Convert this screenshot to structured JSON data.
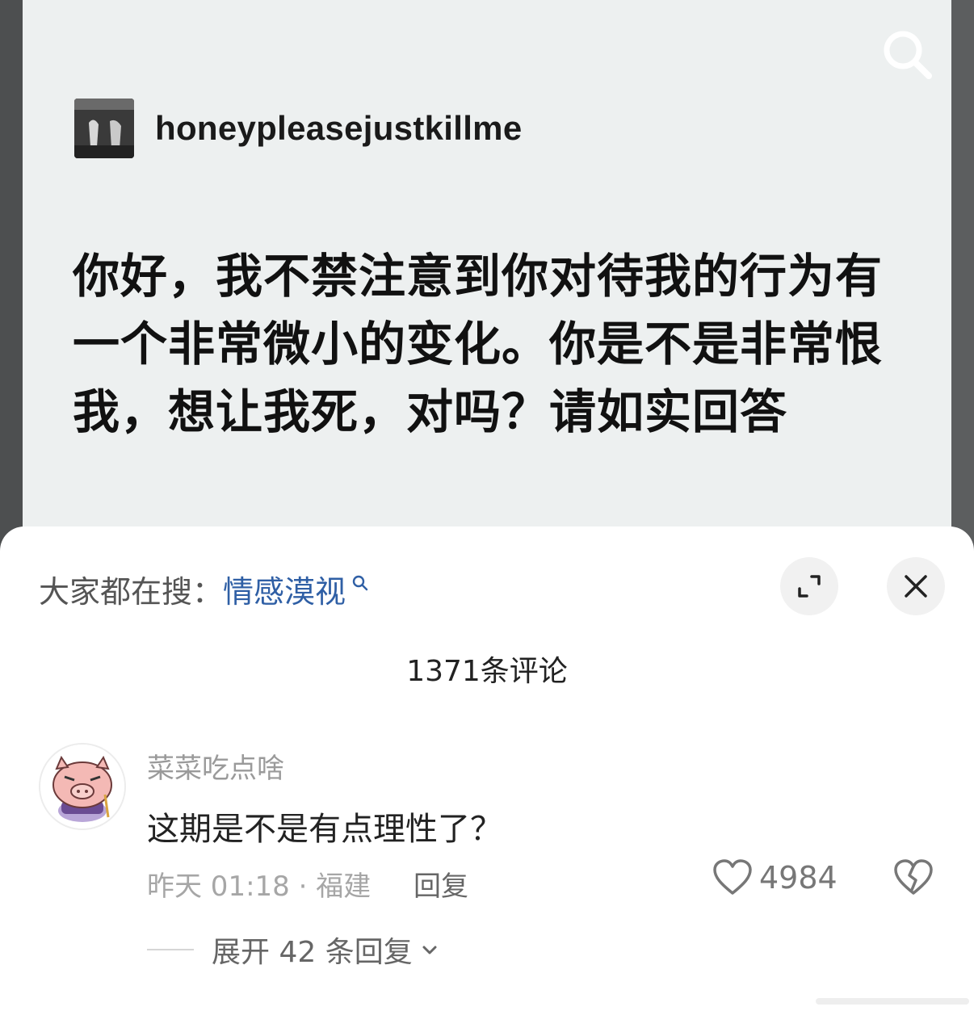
{
  "post": {
    "author": "honeypleasejustkillme",
    "text": "你好，我不禁注意到你对待我的行为有一个非常微小的变化。你是不是非常恨我，想让我死，对吗？请如实回答"
  },
  "sheet": {
    "trending_label": "大家都在搜：",
    "trending_keyword": "情感漠视",
    "comment_count": "1371条评论"
  },
  "comment": {
    "username": "菜菜吃点啥",
    "text": "这期是不是有点理性了？",
    "meta": "昨天 01:18 · 福建",
    "reply_label": "回复",
    "likes": "4984",
    "expand_label": "展开 42 条回复"
  },
  "colors": {
    "keyword": "#2f5fa5",
    "post_bg": "#edf0f0",
    "sheet_bg": "#ffffff"
  },
  "icons": [
    "search-icon",
    "expand-icon",
    "close-icon",
    "heart-icon",
    "broken-heart-icon",
    "chevron-down-icon"
  ]
}
